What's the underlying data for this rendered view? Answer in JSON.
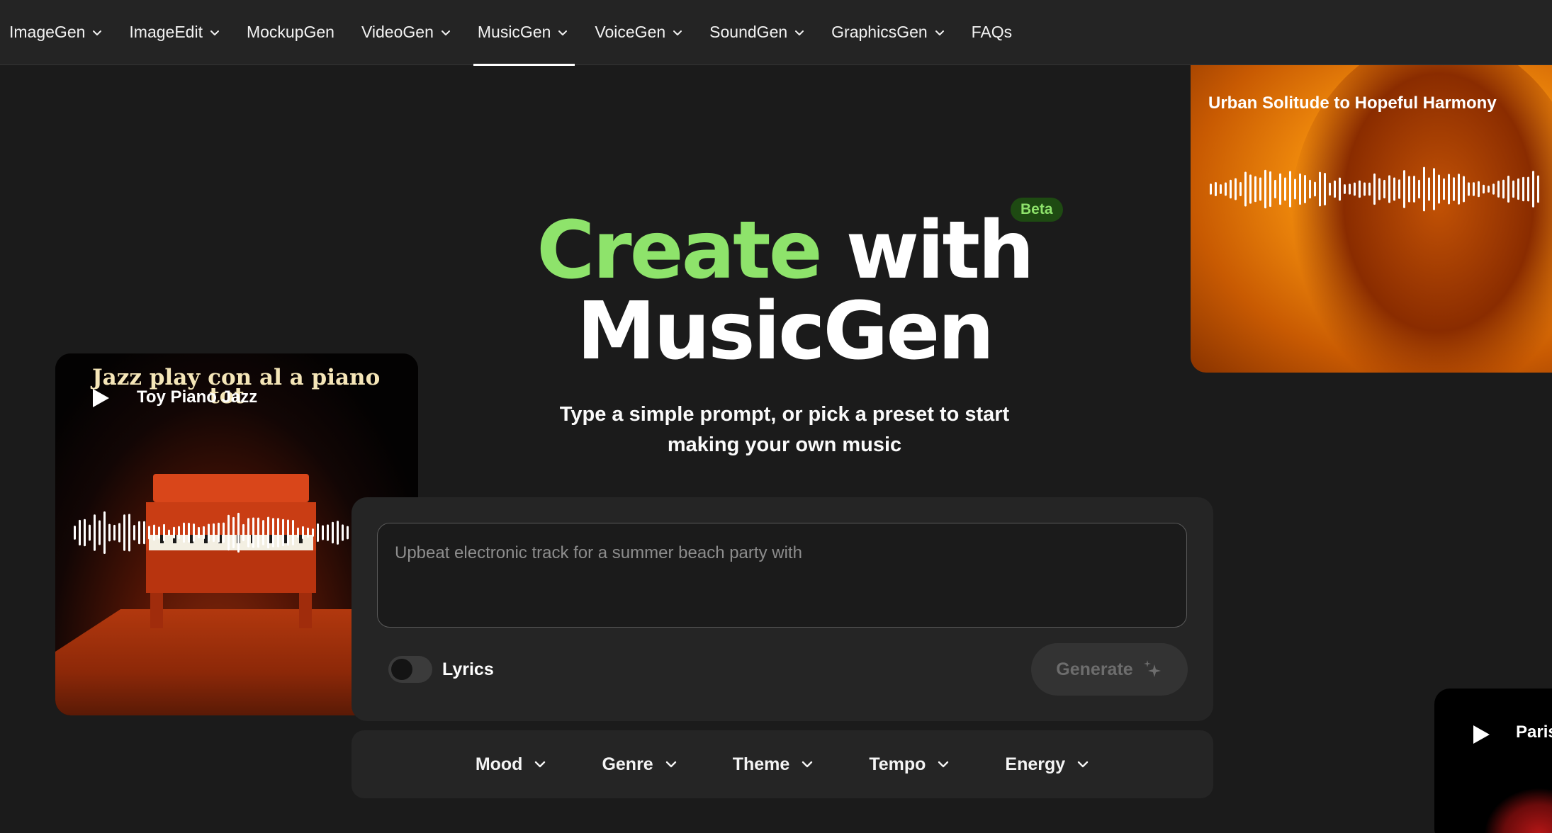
{
  "nav": {
    "items": [
      {
        "label": "ImageGen",
        "dropdown": true,
        "active": false
      },
      {
        "label": "ImageEdit",
        "dropdown": true,
        "active": false
      },
      {
        "label": "MockupGen",
        "dropdown": false,
        "active": false
      },
      {
        "label": "VideoGen",
        "dropdown": true,
        "active": false
      },
      {
        "label": "MusicGen",
        "dropdown": true,
        "active": true
      },
      {
        "label": "VoiceGen",
        "dropdown": true,
        "active": false
      },
      {
        "label": "SoundGen",
        "dropdown": true,
        "active": false
      },
      {
        "label": "GraphicsGen",
        "dropdown": true,
        "active": false
      },
      {
        "label": "FAQs",
        "dropdown": false,
        "active": false
      }
    ]
  },
  "hero": {
    "title_accent": "Create",
    "title_rest": "with",
    "title_line2": "MusicGen",
    "badge": "Beta",
    "subtitle_line1": "Type a simple prompt, or pick a preset to start",
    "subtitle_line2": "making your own music"
  },
  "cards": {
    "left": {
      "cover_text_line1": "Jazz play con al a piano",
      "cover_text_line2": "tot",
      "track_name": "Toy Piano Jazz"
    },
    "right": {
      "track_name": "Urban Solitude to Hopeful Harmony"
    },
    "peek": {
      "track_name": "Paris"
    }
  },
  "prompt": {
    "placeholder": "Upbeat electronic track for a summer beach party with",
    "lyrics_label": "Lyrics",
    "lyrics_enabled": false,
    "generate_label": "Generate"
  },
  "filters": [
    {
      "label": "Mood"
    },
    {
      "label": "Genre"
    },
    {
      "label": "Theme"
    },
    {
      "label": "Tempo"
    },
    {
      "label": "Energy"
    }
  ],
  "colors": {
    "accent_green": "#8ee36b",
    "background": "#1b1b1b",
    "panel": "#252525"
  }
}
